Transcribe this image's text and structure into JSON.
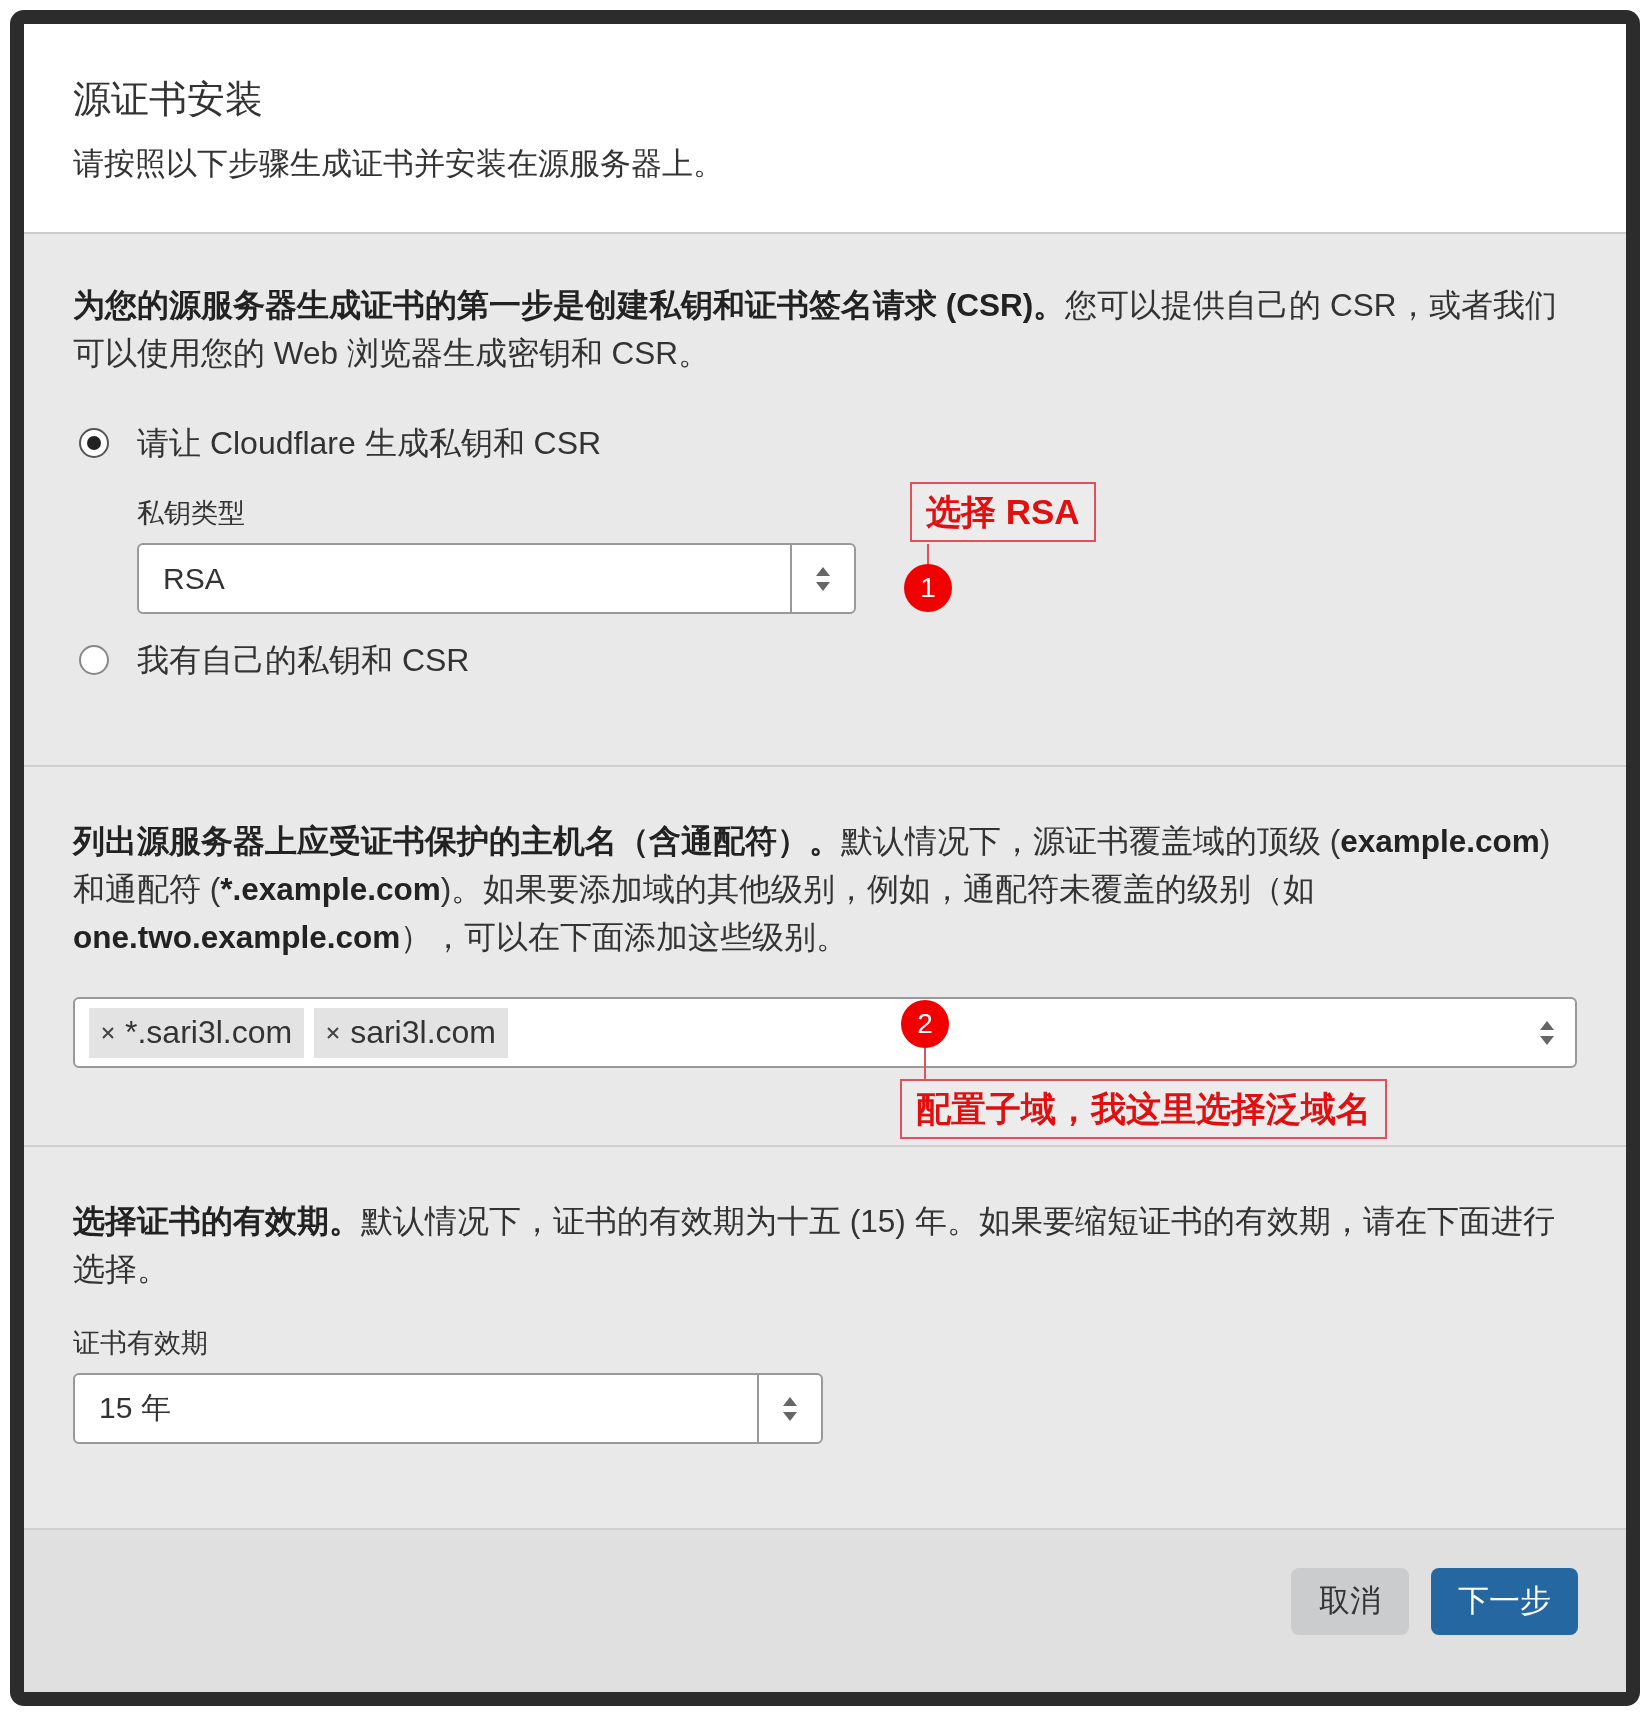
{
  "dialog": {
    "title": "源证书安装",
    "subtitle": "请按照以下步骤生成证书并安装在源服务器上。"
  },
  "key_section": {
    "description": "**为您的源服务器生成证书的第一步是创建私钥和证书签名请求 (CSR)。**您可以提供自己的 CSR，或者我们可以使用您的 Web 浏览器生成密钥和 CSR。",
    "options": [
      {
        "label": "请让 Cloudflare 生成私钥和 CSR",
        "selected": true
      },
      {
        "label": "我有自己的私钥和 CSR",
        "selected": false
      }
    ],
    "key_type": {
      "label": "私钥类型",
      "value": "RSA"
    }
  },
  "hosts_section": {
    "description": "**列出源服务器上应受证书保护的主机名（含通配符）。**默认情况下，源证书覆盖域的顶级 (**example.com**) 和通配符 (***.example.com**)。如果要添加域的其他级别，例如，通配符未覆盖的级别（如 **one.two.example.com**），可以在下面添加这些级别。",
    "tags": [
      "*.sari3l.com",
      "sari3l.com"
    ]
  },
  "validity_section": {
    "description": "**选择证书的有效期。**默认情况下，证书的有效期为十五 (15) 年。如果要缩短证书的有效期，请在下面进行选择。",
    "label": "证书有效期",
    "value": "15 年"
  },
  "buttons": [
    {
      "label": "取消",
      "kind": "secondary"
    },
    {
      "label": "下一步",
      "kind": "primary"
    }
  ],
  "annotations": [
    {
      "number": "1",
      "text": "选择 RSA"
    },
    {
      "number": "2",
      "text": "配置子域，我这里选择泛域名"
    }
  ]
}
